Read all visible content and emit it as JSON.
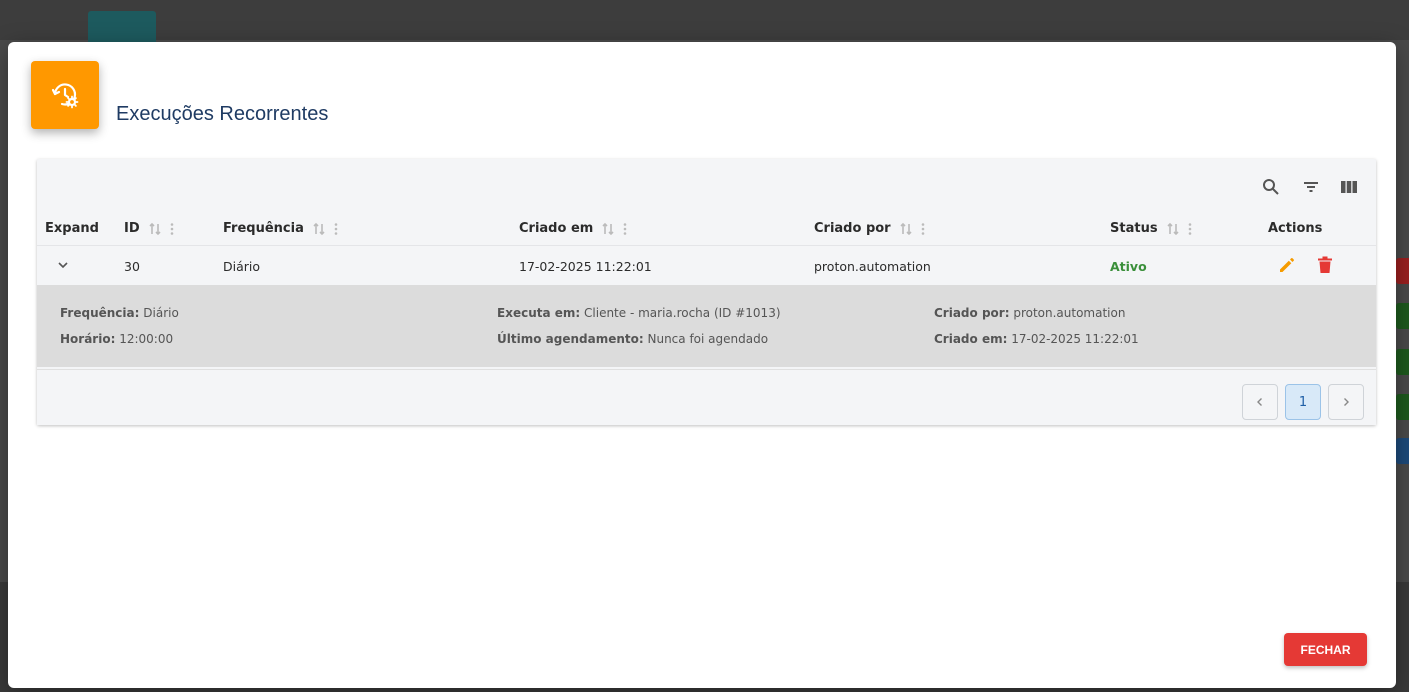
{
  "modal": {
    "title": "Execuções Recorrentes",
    "close_label": "FECHAR"
  },
  "table": {
    "columns": [
      {
        "key": "expand",
        "label": "Expand"
      },
      {
        "key": "id",
        "label": "ID"
      },
      {
        "key": "frequencia",
        "label": "Frequência"
      },
      {
        "key": "criado_em",
        "label": "Criado em"
      },
      {
        "key": "criado_por",
        "label": "Criado por"
      },
      {
        "key": "status",
        "label": "Status"
      },
      {
        "key": "actions",
        "label": "Actions"
      }
    ],
    "rows": [
      {
        "id": "30",
        "frequencia": "Diário",
        "criado_em": "17-02-2025 11:22:01",
        "criado_por": "proton.automation",
        "status": "Ativo"
      }
    ],
    "detail": {
      "frequencia_label": "Frequência:",
      "frequencia_value": "Diário",
      "horario_label": "Horário:",
      "horario_value": "12:00:00",
      "executa_em_label": "Executa em:",
      "executa_em_value": "Cliente - maria.rocha (ID #1013)",
      "ultimo_label": "Último agendamento:",
      "ultimo_value": "Nunca foi agendado",
      "criado_por_label": "Criado por:",
      "criado_por_value": "proton.automation",
      "criado_em_label": "Criado em:",
      "criado_em_value": "17-02-2025 11:22:01"
    },
    "pagination": {
      "current_page": "1"
    }
  },
  "icons": {
    "header": "history-gear-icon",
    "toolbar": [
      "search-icon",
      "filter-icon",
      "columns-icon"
    ],
    "row_actions": [
      "edit-icon",
      "delete-icon"
    ]
  },
  "colors": {
    "accent_orange": "#ff9800",
    "title_blue": "#1f3b63",
    "status_green": "#3a8f3a",
    "danger_red": "#e53935",
    "edit_orange": "#f59b00"
  }
}
